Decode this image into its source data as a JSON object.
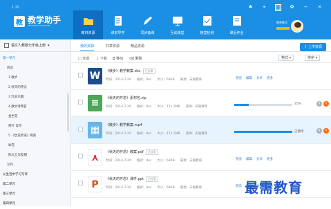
{
  "app": {
    "version": "1.20",
    "logo_badge": "教",
    "logo_cn": "教学助手",
    "logo_en": "TEACHING ASSISTANT"
  },
  "navigation": [
    {
      "label": "教材资源",
      "icon": "folder-icon",
      "active": true
    },
    {
      "label": "课前导学",
      "icon": "book-icon",
      "active": false
    },
    {
      "label": "同步备课",
      "icon": "edit-icon",
      "active": false
    },
    {
      "label": "互动课堂",
      "icon": "screen-icon",
      "active": false
    },
    {
      "label": "随堂检测",
      "icon": "checklist-icon",
      "active": false
    },
    {
      "label": "课后作业",
      "icon": "homework-icon",
      "active": false
    }
  ],
  "window_controls": [
    "bell-icon",
    "location-icon",
    "screen-share-icon",
    "settings-icon",
    "minimize-icon",
    "close-icon"
  ],
  "user": {
    "name": "教师账号"
  },
  "sidebar": {
    "book": "语文人教版七年级上册",
    "items": [
      {
        "label": "第一单元",
        "type": "unit",
        "active": true
      },
      {
        "label": "阅读",
        "type": "normal"
      },
      {
        "label": "1  散步",
        "type": "sub"
      },
      {
        "label": "2  秋天的怀念",
        "type": "sub"
      },
      {
        "label": "3  羚羊木雕",
        "type": "sub"
      },
      {
        "label": "4  散文诗两首",
        "type": "sub"
      },
      {
        "label": "金色花",
        "type": "sub"
      },
      {
        "label": "荷叶 母亲",
        "type": "sub"
      },
      {
        "label": "5  《世说新语》两则",
        "type": "sub"
      },
      {
        "label": "咏雪",
        "type": "sub"
      },
      {
        "label": "陈太丘与友期",
        "type": "sub"
      },
      {
        "label": "写作",
        "type": "normal"
      },
      {
        "label": "从生活中学习写作",
        "type": "unit"
      },
      {
        "label": "第二单元",
        "type": "unit"
      },
      {
        "label": "第三单元",
        "type": "unit"
      },
      {
        "label": "第四单元",
        "type": "unit"
      }
    ]
  },
  "tabs": [
    "我的资源",
    "共享资源",
    "精品资源"
  ],
  "upload_label": "上传资源",
  "toolbar": {
    "select_all": "全选",
    "download": "下载",
    "move": "移动",
    "delete": "删除",
    "format": "格式",
    "sort": "排序"
  },
  "files": [
    {
      "name": "《散步》教学教案.doc",
      "tag": "已分享",
      "time": "时间：2014-7-20",
      "format": "格式：doc",
      "size": "大小：69KB",
      "source": "来源：天喻教育",
      "type": "doc",
      "icon_text": "W",
      "actions": [
        "预览",
        "编辑",
        "分享",
        "更多"
      ]
    },
    {
      "name": "《秋天的怀念》素材包.zip",
      "tag": "",
      "time": "时间：2014-7-20",
      "format": "格式：doc",
      "size": "大小：111.2MB",
      "source": "来源：天喻教育",
      "type": "zip",
      "icon_text": "≡",
      "progress": 25,
      "progress_text": "25%"
    },
    {
      "name": "《散步》教学教案.mp4",
      "tag": "",
      "time": "时间：2014-7-20",
      "format": "格式：doc",
      "size": "大小：111.2MB",
      "source": "来源：天喻教育",
      "type": "mp4",
      "icon_text": "▦",
      "progress": 100,
      "progress_text": "已暂停"
    },
    {
      "name": "《秋天的怀念》教案.pdf",
      "tag": "已分享",
      "time": "时间：2014-7-20",
      "format": "格式：doc",
      "size": "大小：69KB",
      "source": "来源：天喻教育",
      "type": "pdf",
      "icon_text": "⋏",
      "actions": [
        "预览",
        "编辑",
        "分享",
        "更多"
      ]
    },
    {
      "name": "《秋天的怀念》课件.ppt",
      "tag": "已分享",
      "time": "时间：2014-7-20",
      "format": "格式：doc",
      "size": "大小：69KB",
      "source": "来源：天喻教育",
      "type": "ppt",
      "icon_text": "P",
      "actions": [
        "预览",
        "编辑",
        "分享",
        "更多"
      ]
    }
  ],
  "watermark": "最需教育",
  "colors": {
    "primary": "#1a8fe3",
    "dark_primary": "#0d6ec2",
    "warning": "#ff6a00"
  }
}
